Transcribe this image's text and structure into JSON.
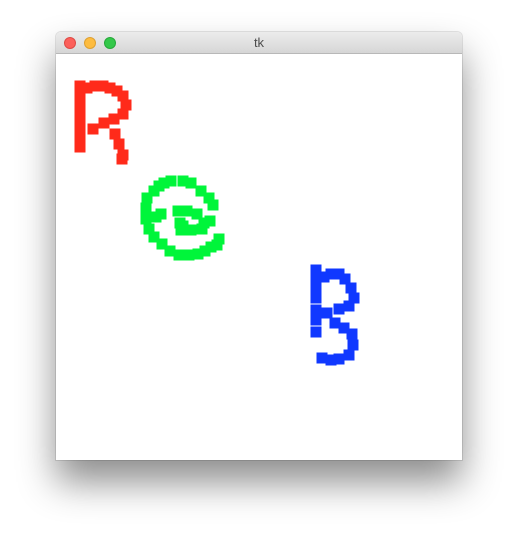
{
  "window": {
    "title": "tk"
  },
  "canvas": {
    "background": "#ffffff",
    "strokes": [
      {
        "letter": "R",
        "color": "#ff2a1a"
      },
      {
        "letter": "G",
        "color": "#00f53a"
      },
      {
        "letter": "B",
        "color": "#1038ff"
      }
    ]
  },
  "icons": {
    "close": "close-icon",
    "minimize": "minimize-icon",
    "zoom": "zoom-icon"
  },
  "colors": {
    "close": "#fc605b",
    "minimize": "#fdbc40",
    "zoom": "#34c84a"
  }
}
